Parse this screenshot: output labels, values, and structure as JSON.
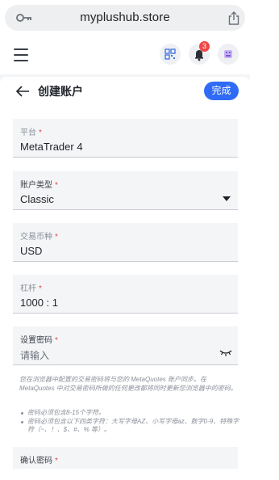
{
  "browser": {
    "url": "myplushub.store",
    "icons": [
      "key-icon",
      "share-icon"
    ]
  },
  "header": {
    "notification_count": "3",
    "icons": [
      "menu-icon",
      "qr-code-icon",
      "bell-icon",
      "avatar-icon"
    ]
  },
  "page": {
    "title": "创建账户",
    "done_label": "完成"
  },
  "form": {
    "platform": {
      "label": "平台",
      "required": "*",
      "value": "MetaTrader 4"
    },
    "account_type": {
      "label": "账户类型",
      "required": "*",
      "value": "Classic"
    },
    "currency": {
      "label": "交易币种",
      "required": "*",
      "value": "USD"
    },
    "leverage": {
      "label": "杠杆",
      "required": "*",
      "value": "1000 : 1"
    },
    "password": {
      "label": "设置密码",
      "required": "*",
      "placeholder": "请输入"
    },
    "confirm_password": {
      "label": "确认密码",
      "required": "*"
    }
  },
  "hint": "您在浏览器中配置的交易密码将与您的 MetaQuotes 账户同步。在 MetaQuotes 中对交易密码所做的任何更改都将同时更新您浏览器中的密码。",
  "rules": [
    "密码必须包含8-15个字符。",
    "密码必须包含以下四类字符：大写字母AZ、小写字母az、数字0-9、特殊字符（~、！、$、#、% 等）。"
  ],
  "colors": {
    "accent": "#2f6bf6",
    "badge": "#f04646",
    "required": "#e5484d"
  }
}
